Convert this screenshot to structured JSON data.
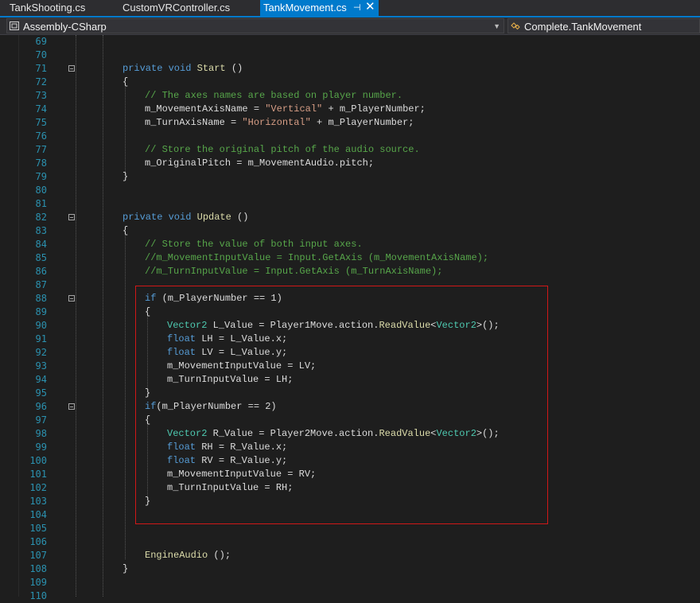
{
  "tabs": [
    {
      "label": "TankShooting.cs"
    },
    {
      "label": "CustomVRController.cs"
    },
    {
      "label": "TankMovement.cs",
      "active": true
    }
  ],
  "tab_pin_icon": "pin-icon",
  "tab_close_icon": "close-icon",
  "navbar": {
    "project": "Assembly-CSharp",
    "member": "Complete.TankMovement"
  },
  "colors": {
    "keyword": "#569cd6",
    "string": "#d69d85",
    "comment": "#57a64a",
    "type": "#4ec9b0",
    "method": "#dcdcaa",
    "line_number": "#2b91af",
    "highlight_box": "#d01818",
    "active_tab": "#007acc"
  },
  "lines": [
    {
      "n": "69",
      "indent": 0,
      "tokens": []
    },
    {
      "n": "70",
      "indent": 0,
      "tokens": []
    },
    {
      "n": "71",
      "indent": 1,
      "fold": true,
      "tokens": [
        [
          "kw",
          "private "
        ],
        [
          "kw",
          "void "
        ],
        [
          "fn",
          "Start"
        ],
        [
          "id",
          " ()"
        ]
      ]
    },
    {
      "n": "72",
      "indent": 1,
      "tokens": [
        [
          "id",
          "{"
        ]
      ]
    },
    {
      "n": "73",
      "indent": 2,
      "tokens": [
        [
          "cm",
          "// The axes names are based on player number."
        ]
      ]
    },
    {
      "n": "74",
      "indent": 2,
      "tokens": [
        [
          "id",
          "m_MovementAxisName = "
        ],
        [
          "str",
          "\"Vertical\""
        ],
        [
          "id",
          " + m_PlayerNumber;"
        ]
      ]
    },
    {
      "n": "75",
      "indent": 2,
      "tokens": [
        [
          "id",
          "m_TurnAxisName = "
        ],
        [
          "str",
          "\"Horizontal\""
        ],
        [
          "id",
          " + m_PlayerNumber;"
        ]
      ]
    },
    {
      "n": "76",
      "indent": 0,
      "tokens": []
    },
    {
      "n": "77",
      "indent": 2,
      "tokens": [
        [
          "cm",
          "// Store the original pitch of the audio source."
        ]
      ]
    },
    {
      "n": "78",
      "indent": 2,
      "tokens": [
        [
          "id",
          "m_OriginalPitch = m_MovementAudio.pitch;"
        ]
      ]
    },
    {
      "n": "79",
      "indent": 1,
      "tokens": [
        [
          "id",
          "}"
        ]
      ]
    },
    {
      "n": "80",
      "indent": 0,
      "tokens": []
    },
    {
      "n": "81",
      "indent": 0,
      "tokens": []
    },
    {
      "n": "82",
      "indent": 1,
      "fold": true,
      "tokens": [
        [
          "kw",
          "private "
        ],
        [
          "kw",
          "void "
        ],
        [
          "fn",
          "Update"
        ],
        [
          "id",
          " ()"
        ]
      ]
    },
    {
      "n": "83",
      "indent": 1,
      "tokens": [
        [
          "id",
          "{"
        ]
      ]
    },
    {
      "n": "84",
      "indent": 2,
      "tokens": [
        [
          "cm",
          "// Store the value of both input axes."
        ]
      ]
    },
    {
      "n": "85",
      "indent": 2,
      "tokens": [
        [
          "cm",
          "//m_MovementInputValue = Input.GetAxis (m_MovementAxisName);"
        ]
      ]
    },
    {
      "n": "86",
      "indent": 2,
      "tokens": [
        [
          "cm",
          "//m_TurnInputValue = Input.GetAxis (m_TurnAxisName);"
        ]
      ]
    },
    {
      "n": "87",
      "indent": 0,
      "tokens": []
    },
    {
      "n": "88",
      "indent": 2,
      "fold": true,
      "tokens": [
        [
          "kw",
          "if"
        ],
        [
          "id",
          " (m_PlayerNumber == 1)"
        ]
      ]
    },
    {
      "n": "89",
      "indent": 2,
      "tokens": [
        [
          "id",
          "{"
        ]
      ]
    },
    {
      "n": "90",
      "indent": 3,
      "tokens": [
        [
          "ty",
          "Vector2"
        ],
        [
          "id",
          " L_Value = Player1Move.action."
        ],
        [
          "fn",
          "ReadValue"
        ],
        [
          "id",
          "<"
        ],
        [
          "ty",
          "Vector2"
        ],
        [
          "id",
          ">();"
        ]
      ]
    },
    {
      "n": "91",
      "indent": 3,
      "tokens": [
        [
          "kw",
          "float"
        ],
        [
          "id",
          " LH = L_Value.x;"
        ]
      ]
    },
    {
      "n": "92",
      "indent": 3,
      "tokens": [
        [
          "kw",
          "float"
        ],
        [
          "id",
          " LV = L_Value.y;"
        ]
      ]
    },
    {
      "n": "93",
      "indent": 3,
      "tokens": [
        [
          "id",
          "m_MovementInputValue = LV;"
        ]
      ]
    },
    {
      "n": "94",
      "indent": 3,
      "tokens": [
        [
          "id",
          "m_TurnInputValue = LH;"
        ]
      ]
    },
    {
      "n": "95",
      "indent": 2,
      "tokens": [
        [
          "id",
          "}"
        ]
      ]
    },
    {
      "n": "96",
      "indent": 2,
      "fold": true,
      "tokens": [
        [
          "kw",
          "if"
        ],
        [
          "id",
          "(m_PlayerNumber == 2)"
        ]
      ]
    },
    {
      "n": "97",
      "indent": 2,
      "tokens": [
        [
          "id",
          "{"
        ]
      ]
    },
    {
      "n": "98",
      "indent": 3,
      "tokens": [
        [
          "ty",
          "Vector2"
        ],
        [
          "id",
          " R_Value = Player2Move.action."
        ],
        [
          "fn",
          "ReadValue"
        ],
        [
          "id",
          "<"
        ],
        [
          "ty",
          "Vector2"
        ],
        [
          "id",
          ">();"
        ]
      ]
    },
    {
      "n": "99",
      "indent": 3,
      "tokens": [
        [
          "kw",
          "float"
        ],
        [
          "id",
          " RH = R_Value.x;"
        ]
      ]
    },
    {
      "n": "100",
      "indent": 3,
      "tokens": [
        [
          "kw",
          "float"
        ],
        [
          "id",
          " RV = R_Value.y;"
        ]
      ]
    },
    {
      "n": "101",
      "indent": 3,
      "tokens": [
        [
          "id",
          "m_MovementInputValue = RV;"
        ]
      ]
    },
    {
      "n": "102",
      "indent": 3,
      "tokens": [
        [
          "id",
          "m_TurnInputValue = RH;"
        ]
      ]
    },
    {
      "n": "103",
      "indent": 2,
      "tokens": [
        [
          "id",
          "}"
        ]
      ]
    },
    {
      "n": "104",
      "indent": 0,
      "tokens": []
    },
    {
      "n": "105",
      "indent": 0,
      "tokens": []
    },
    {
      "n": "106",
      "indent": 0,
      "tokens": []
    },
    {
      "n": "107",
      "indent": 2,
      "tokens": [
        [
          "fn",
          "EngineAudio"
        ],
        [
          "id",
          " ();"
        ]
      ]
    },
    {
      "n": "108",
      "indent": 1,
      "tokens": [
        [
          "id",
          "}"
        ]
      ]
    },
    {
      "n": "109",
      "indent": 0,
      "tokens": []
    },
    {
      "n": "110",
      "indent": 0,
      "tokens": []
    }
  ]
}
